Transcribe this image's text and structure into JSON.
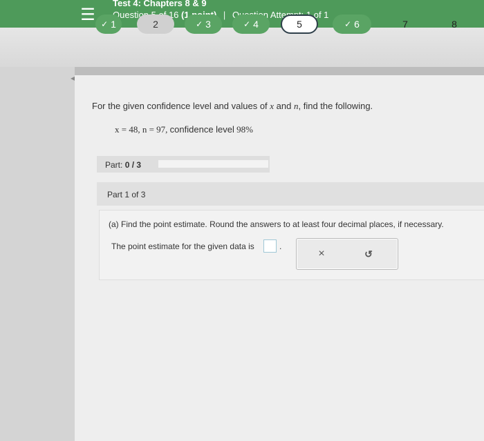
{
  "header": {
    "menu_icon": "hamburger-menu-icon",
    "test_title": "Test 4: Chapters 8 & 9",
    "question_info": "Question 5 of 16",
    "points": "(1 point)",
    "attempt": "Question Attempt: 1 of 1"
  },
  "question_nav": [
    {
      "label": "1",
      "status": "completed"
    },
    {
      "label": "2",
      "status": "unanswered"
    },
    {
      "label": "3",
      "status": "completed"
    },
    {
      "label": "4",
      "status": "completed"
    },
    {
      "label": "5",
      "status": "current"
    },
    {
      "label": "6",
      "status": "completed"
    },
    {
      "label": "7",
      "status": "unanswered"
    },
    {
      "label": "8",
      "status": "unanswered"
    }
  ],
  "check_mark": "✓",
  "problem": {
    "prompt_a": "For the given confidence level and values of ",
    "var_x": "x",
    "prompt_b": " and ",
    "var_n": "n",
    "prompt_c": ", find the following.",
    "given_values": "x = 48, n = 97, ",
    "given_label": "confidence level",
    "given_level": " 98%"
  },
  "progress": {
    "label": "Part:",
    "value": "0 / 3",
    "fraction": 0
  },
  "part": {
    "header": "Part 1 of 3",
    "instruction": "(a) Find the point estimate. Round the answers to at least four decimal places, if necessary.",
    "answer_label": "The point estimate for the given data is",
    "answer_value": "",
    "period": ".",
    "clear_symbol": "×",
    "undo_symbol": "↺",
    "clear_icon": "clear-x-icon",
    "undo_icon": "undo-icon"
  },
  "colors": {
    "topbar": "#4e9a5a",
    "completed": "#5aa464",
    "current_border": "#2f3f4a",
    "answer_box_border": "#9fc7d6"
  }
}
